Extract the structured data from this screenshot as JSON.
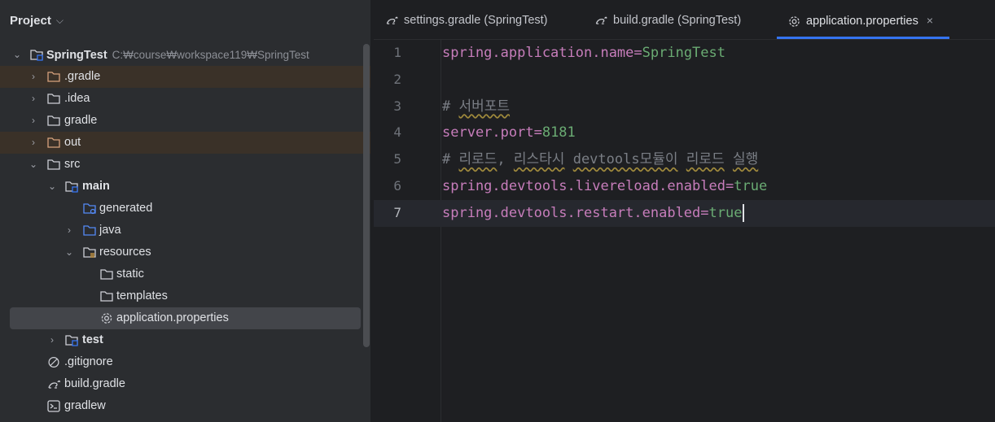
{
  "panel": {
    "title": "Project"
  },
  "tree": [
    {
      "name": "root",
      "label": "SpringTest",
      "path": "C:₩course₩workspace119₩SpringTest",
      "icon": "module-folder-icon",
      "expanded": true
    },
    {
      "name": "gradle-dir",
      "label": ".gradle",
      "icon": "folder-icon",
      "excluded": true
    },
    {
      "name": "idea-dir",
      "label": ".idea",
      "icon": "folder-icon"
    },
    {
      "name": "gradle-folder",
      "label": "gradle",
      "icon": "folder-icon"
    },
    {
      "name": "out-dir",
      "label": "out",
      "icon": "folder-icon",
      "excluded": true
    },
    {
      "name": "src-dir",
      "label": "src",
      "icon": "folder-icon"
    },
    {
      "name": "main-dir",
      "label": "main",
      "icon": "module-folder-icon"
    },
    {
      "name": "generated-dir",
      "label": "generated",
      "icon": "generated-folder-icon"
    },
    {
      "name": "java-dir",
      "label": "java",
      "icon": "source-folder-icon"
    },
    {
      "name": "resources-dir",
      "label": "resources",
      "icon": "resources-folder-icon"
    },
    {
      "name": "static-dir",
      "label": "static",
      "icon": "folder-icon"
    },
    {
      "name": "templates-dir",
      "label": "templates",
      "icon": "folder-icon"
    },
    {
      "name": "application-properties-file",
      "label": "application.properties",
      "icon": "gear-icon"
    },
    {
      "name": "test-dir",
      "label": "test",
      "icon": "module-folder-icon"
    },
    {
      "name": "gitignore-file",
      "label": ".gitignore",
      "icon": "ignore-icon"
    },
    {
      "name": "build-gradle-file",
      "label": "build.gradle",
      "icon": "gradle-icon"
    },
    {
      "name": "gradlew-file",
      "label": "gradlew",
      "icon": "terminal-icon"
    }
  ],
  "tabs": [
    {
      "label": "settings.gradle (SpringTest)",
      "icon": "gradle-icon"
    },
    {
      "label": "build.gradle (SpringTest)",
      "icon": "gradle-icon"
    },
    {
      "label": "application.properties",
      "icon": "gear-icon",
      "close": "×"
    }
  ],
  "editor": {
    "line_numbers": [
      "1",
      "2",
      "3",
      "4",
      "5",
      "6",
      "7"
    ],
    "lines": {
      "l1_key": "spring.application.name=",
      "l1_val": "SpringTest",
      "l3_hash": "# ",
      "l3_comment": "서버포트",
      "l4_key": "server.port=",
      "l4_val": "8181",
      "l5_a": "# ",
      "l5_b": "리로드",
      "l5_c": ", ",
      "l5_d": "리스타시",
      "l5_e": " ",
      "l5_f": "devtools모듈이",
      "l5_g": " ",
      "l5_h": "리로드",
      "l5_i": " ",
      "l5_j": "실행",
      "l6_key": "spring.devtools.livereload.enabled=",
      "l6_val": "true",
      "l7_key": "spring.devtools.restart.enabled=",
      "l7_val": "true"
    }
  }
}
